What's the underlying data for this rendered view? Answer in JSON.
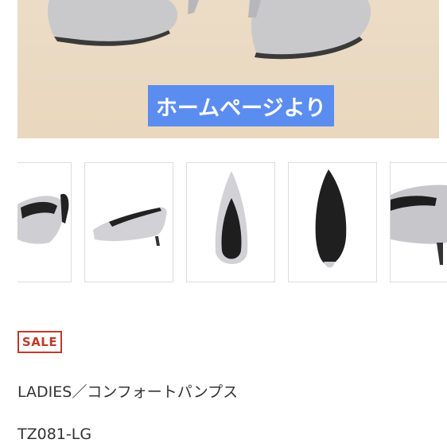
{
  "hero": {
    "banner_text": "ホームページより"
  },
  "gallery": {
    "thumbnails": [
      {
        "alt": "pump-angle-left"
      },
      {
        "alt": "pump-side"
      },
      {
        "alt": "pump-top"
      },
      {
        "alt": "pump-sole"
      },
      {
        "alt": "pump-heel-closeup"
      }
    ]
  },
  "product": {
    "sale_badge": "SALE",
    "name": "LADIES／コンフォートパンプス",
    "code": "TZ081-LG"
  },
  "colors": {
    "banner_bg": "#5b8df0",
    "sale_red": "#c0392b",
    "hero_bg": "#ecdcc6",
    "shoe_gray": "#c9c9cc"
  }
}
